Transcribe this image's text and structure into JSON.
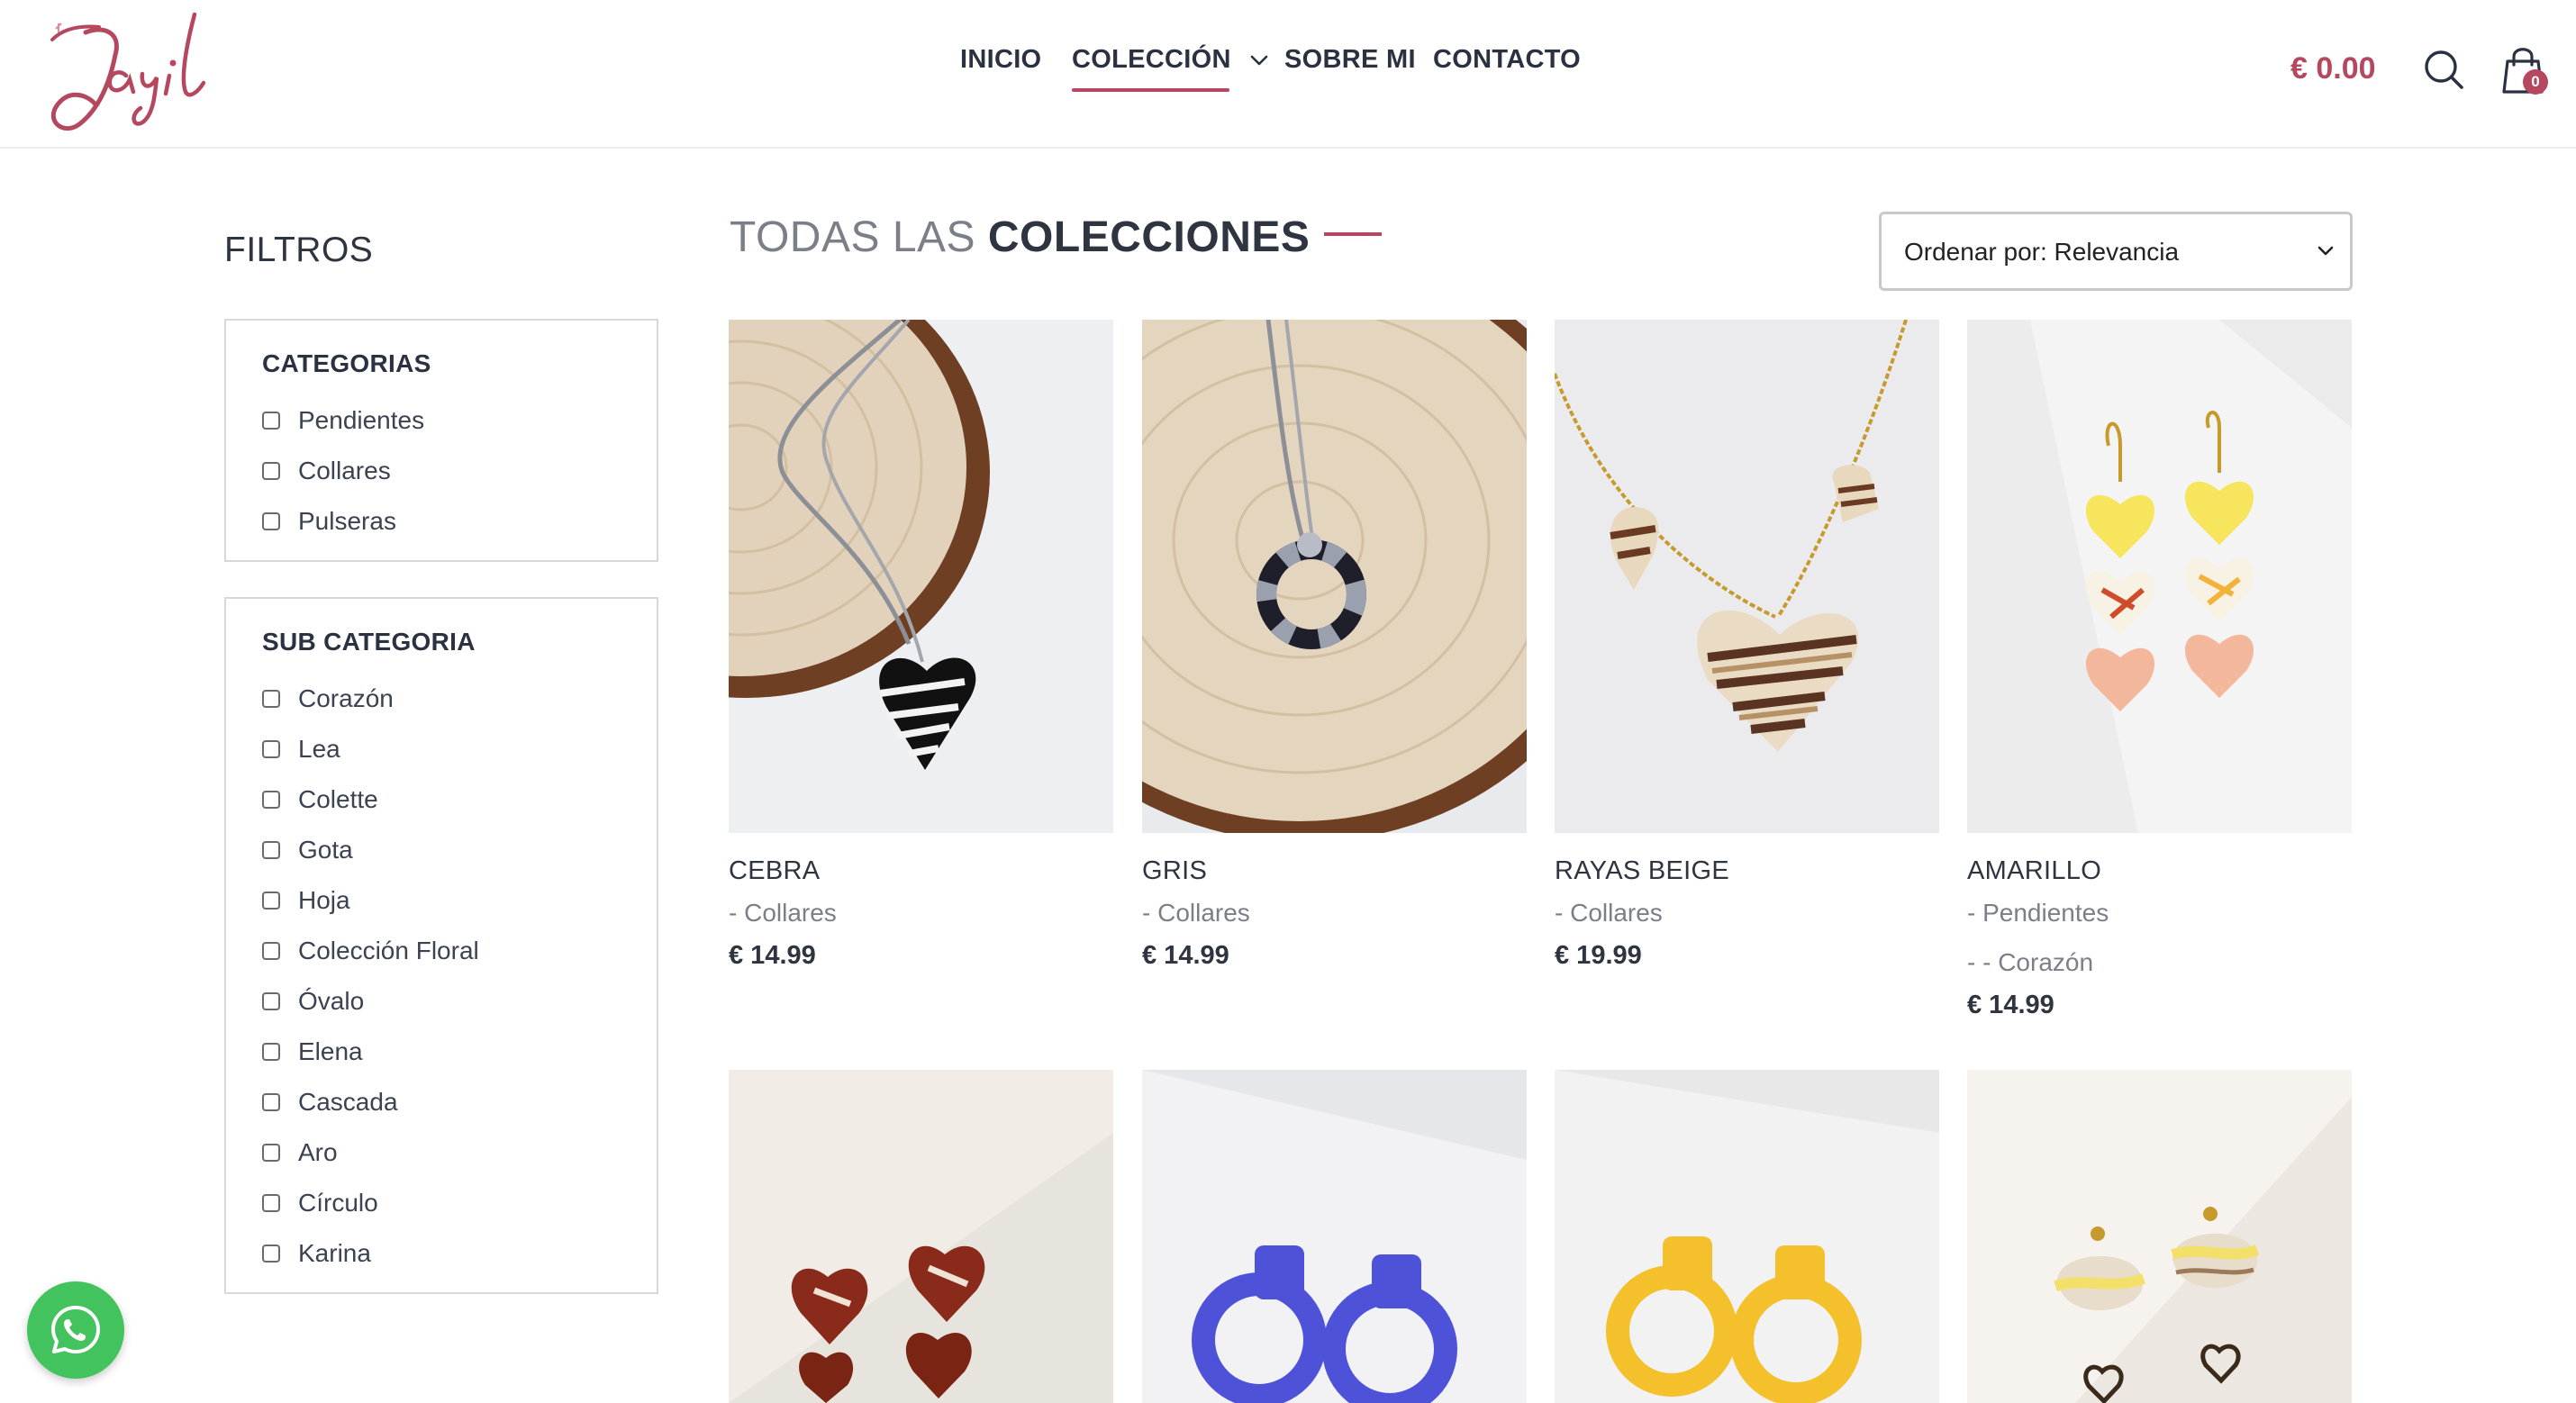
{
  "brand": {
    "logo_text": "Jayil",
    "accent_color": "#b5485f"
  },
  "nav": {
    "items": [
      {
        "label": "INICIO"
      },
      {
        "label": "COLECCIÓN",
        "active": true,
        "has_dropdown": true
      },
      {
        "label": "SOBRE MI"
      },
      {
        "label": "CONTACTO"
      }
    ]
  },
  "header": {
    "cart_total": "€ 0.00",
    "cart_count": "0",
    "icons": [
      "search-icon",
      "shopping-bag-icon"
    ]
  },
  "sidebar": {
    "title": "FILTROS",
    "categories": {
      "title": "CATEGORIAS",
      "items": [
        "Pendientes",
        "Collares",
        "Pulseras"
      ]
    },
    "subcategories": {
      "title": "SUB CATEGORIA",
      "items": [
        "Corazón",
        "Lea",
        "Colette",
        "Gota",
        "Hoja",
        "Colección Floral",
        "Óvalo",
        "Elena",
        "Cascada",
        "Aro",
        "Círculo",
        "Karina"
      ]
    }
  },
  "main": {
    "title_light": "TODAS LAS",
    "title_bold": "COLECCIONES",
    "sort": {
      "label": "Ordenar por: Relevancia"
    },
    "products": [
      {
        "name": "CEBRA",
        "category": "- Collares",
        "price": "€ 14.99"
      },
      {
        "name": "GRIS",
        "category": "- Collares",
        "price": "€ 14.99"
      },
      {
        "name": "RAYAS BEIGE",
        "category": "- Collares",
        "price": "€ 19.99"
      },
      {
        "name": "AMARILLO",
        "category": "- Pendientes",
        "subcategory": "- - Corazón",
        "price": "€ 14.99"
      },
      {
        "name": "",
        "image": "red-heart-earrings"
      },
      {
        "name": "",
        "image": "blue-hoop-earrings"
      },
      {
        "name": "",
        "image": "yellow-hoop-earrings"
      },
      {
        "name": "",
        "image": "beige-stone-earrings"
      }
    ]
  },
  "whatsapp": {
    "icon": "whatsapp-icon",
    "color": "#43c35d"
  }
}
